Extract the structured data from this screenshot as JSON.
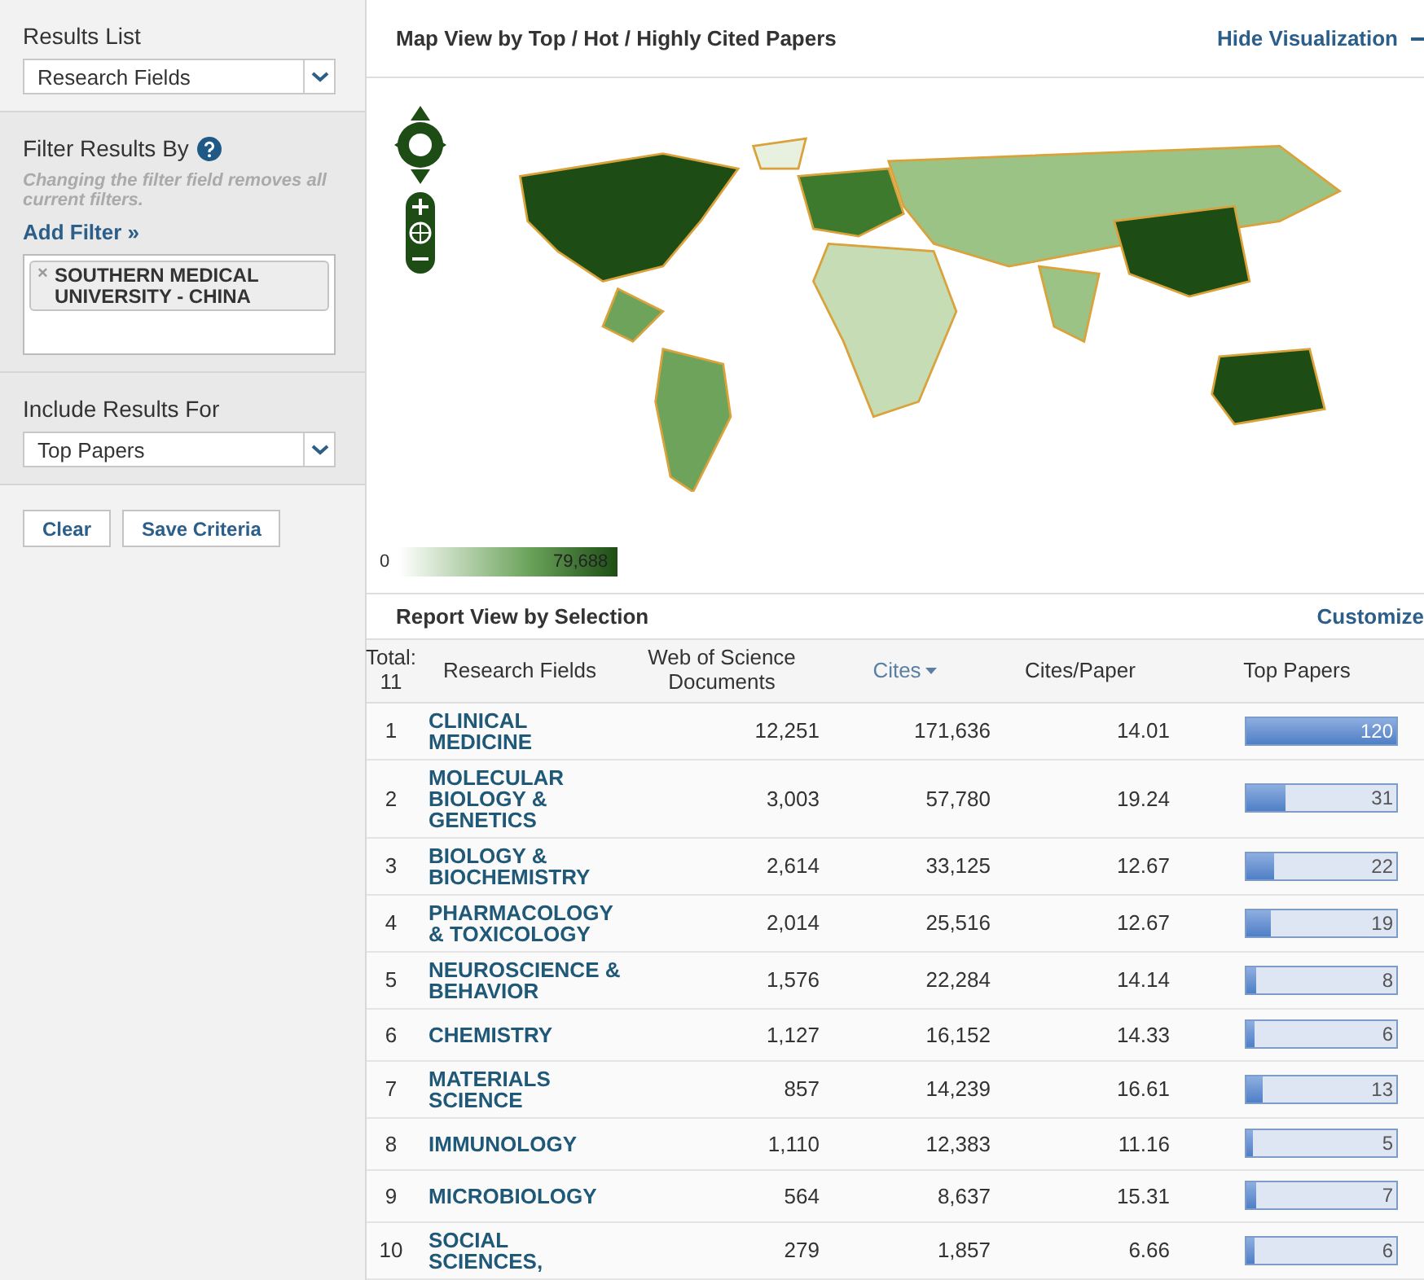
{
  "sidebar": {
    "results_list": {
      "label": "Results List",
      "value": "Research Fields"
    },
    "filter": {
      "label": "Filter Results By",
      "hint": "Changing the filter field removes all current filters.",
      "add_filter": "Add Filter »",
      "chips": [
        {
          "remove": "×",
          "label": "SOUTHERN MEDICAL UNIVERSITY - CHINA"
        }
      ]
    },
    "include": {
      "label": "Include Results For",
      "value": "Top Papers"
    },
    "buttons": [
      "Clear",
      "Save Criteria"
    ]
  },
  "map_panel": {
    "title": "Map View by Top / Hot / Highly Cited Papers",
    "toggle": "Hide Visualization",
    "legend_min": "0",
    "legend_max": "79,688"
  },
  "report": {
    "title": "Report View by Selection",
    "customize": "Customize",
    "columns": [
      {
        "label": "Total: 11",
        "sorted": false
      },
      {
        "label": "Research Fields",
        "sorted": false
      },
      {
        "label": "Web of Science Documents",
        "sorted": false
      },
      {
        "label": "Cites",
        "sorted": true
      },
      {
        "label": "Cites/Paper",
        "sorted": false
      },
      {
        "label": "Top Papers",
        "sorted": false
      }
    ],
    "rows": [
      {
        "rank": "1",
        "field": "CLINICAL MEDICINE",
        "documents": "12,251",
        "cites": "171,636",
        "cites_per_paper": "14.01",
        "top_papers": "120",
        "level": 1
      },
      {
        "rank": "2",
        "field": "MOLECULAR BIOLOGY & GENETICS",
        "documents": "3,003",
        "cites": "57,780",
        "cites_per_paper": "19.24",
        "top_papers": "31",
        "level": 0.26
      },
      {
        "rank": "3",
        "field": "BIOLOGY & BIOCHEMISTRY",
        "documents": "2,614",
        "cites": "33,125",
        "cites_per_paper": "12.67",
        "top_papers": "22",
        "level": 0.18
      },
      {
        "rank": "4",
        "field": "PHARMACOLOGY & TOXICOLOGY",
        "documents": "2,014",
        "cites": "25,516",
        "cites_per_paper": "12.67",
        "top_papers": "19",
        "level": 0.16
      },
      {
        "rank": "5",
        "field": "NEUROSCIENCE & BEHAVIOR",
        "documents": "1,576",
        "cites": "22,284",
        "cites_per_paper": "14.14",
        "top_papers": "8",
        "level": 0.07
      },
      {
        "rank": "6",
        "field": "CHEMISTRY",
        "documents": "1,127",
        "cites": "16,152",
        "cites_per_paper": "14.33",
        "top_papers": "6",
        "level": 0.05
      },
      {
        "rank": "7",
        "field": "MATERIALS SCIENCE",
        "documents": "857",
        "cites": "14,239",
        "cites_per_paper": "16.61",
        "top_papers": "13",
        "level": 0.11
      },
      {
        "rank": "8",
        "field": "IMMUNOLOGY",
        "documents": "1,110",
        "cites": "12,383",
        "cites_per_paper": "11.16",
        "top_papers": "5",
        "level": 0.04
      },
      {
        "rank": "9",
        "field": "MICROBIOLOGY",
        "documents": "564",
        "cites": "8,637",
        "cites_per_paper": "15.31",
        "top_papers": "7",
        "level": 0.06
      },
      {
        "rank": "10",
        "field": "SOCIAL SCIENCES,",
        "documents": "279",
        "cites": "1,857",
        "cites_per_paper": "6.66",
        "top_papers": "6",
        "level": 0.05
      }
    ]
  }
}
